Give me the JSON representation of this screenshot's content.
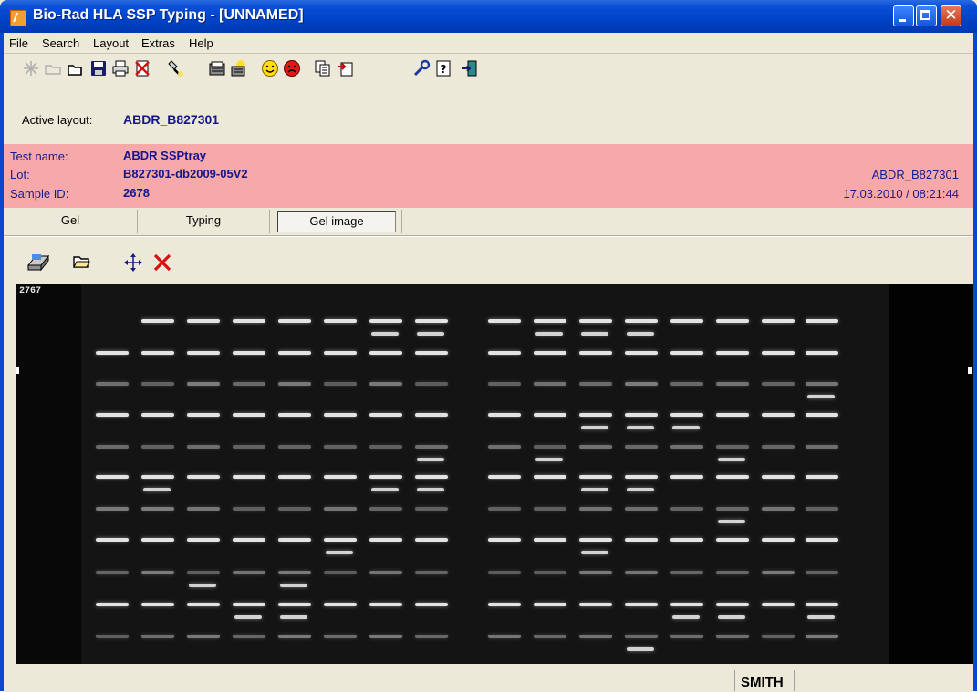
{
  "window": {
    "title": "Bio-Rad HLA SSP Typing - [UNNAMED]"
  },
  "menu": [
    "File",
    "Search",
    "Layout",
    "Extras",
    "Help"
  ],
  "toolbar": {
    "icons": [
      "new-icon",
      "open-disabled-icon",
      "folder-icon",
      "save-icon",
      "print-icon",
      "delete-icon",
      "flashlight-icon",
      "database-icon",
      "database-sun-icon",
      "smiley-happy-icon",
      "smiley-sad-icon",
      "copy-icon",
      "export-icon",
      "wrench-icon",
      "help-icon",
      "exit-icon"
    ]
  },
  "active_layout": {
    "label": "Active layout:",
    "value": "ABDR_B827301"
  },
  "info": {
    "test_label": "Test name:",
    "test_value": "ABDR SSPtray",
    "lot_label": "Lot:",
    "lot_value": "B827301-db2009-05V2",
    "sample_label": "Sample ID:",
    "sample_value": "2678",
    "right_layout": "ABDR_B827301",
    "right_datetime": "17.03.2010 / 08:21:44"
  },
  "tabs": [
    "Gel",
    "Typing",
    "Gel image"
  ],
  "selected_tab": "Gel image",
  "toolbar2": {
    "icons": [
      "scanner-icon",
      "open-folder-icon",
      "move-icon",
      "close-red-icon"
    ]
  },
  "gel": {
    "label": "2767"
  },
  "status": {
    "name": "SMITH"
  },
  "colors": {
    "title_bar": "#0043c8",
    "info_band": "#f7a8a8",
    "info_text": "#16168c",
    "chrome": "#ece9d8"
  }
}
